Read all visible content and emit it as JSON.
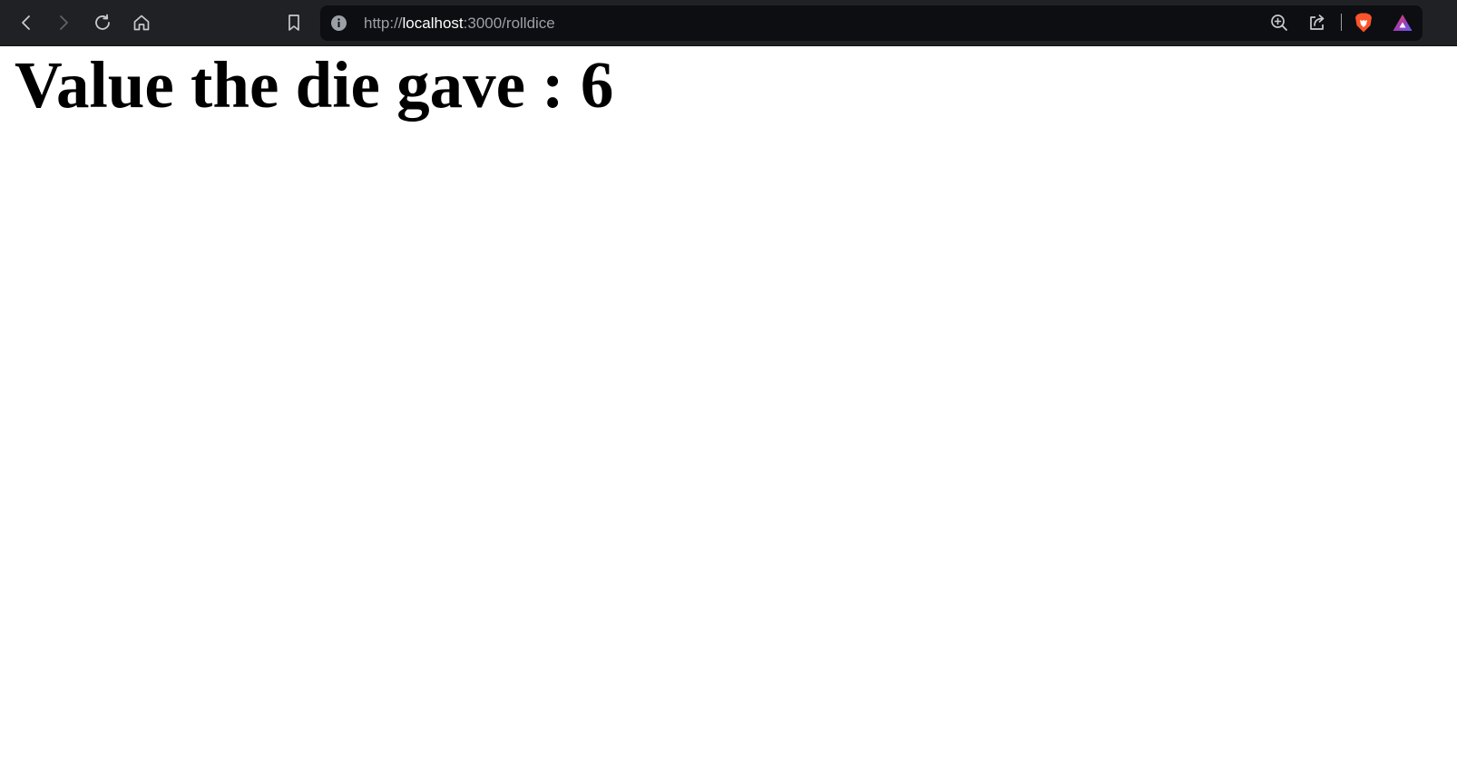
{
  "browser": {
    "url_scheme": "http://",
    "url_host": "localhost",
    "url_path": ":3000/rolldice",
    "icons": {
      "back": "back-arrow-icon",
      "forward": "forward-arrow-icon",
      "reload": "reload-icon",
      "home": "home-icon",
      "bookmark": "bookmark-icon",
      "site_info": "info-icon",
      "zoom": "zoom-in-icon",
      "share": "share-icon",
      "brave_shields": "brave-lion-icon",
      "brave_rewards": "brave-rewards-triangle-icon"
    },
    "colors": {
      "toolbar_bg": "#202124",
      "urlbar_bg": "#0d0e11",
      "brave_orange": "#fb542b",
      "rewards_purple": "#a43bb4"
    }
  },
  "page": {
    "heading": "Value the die gave : 6"
  }
}
